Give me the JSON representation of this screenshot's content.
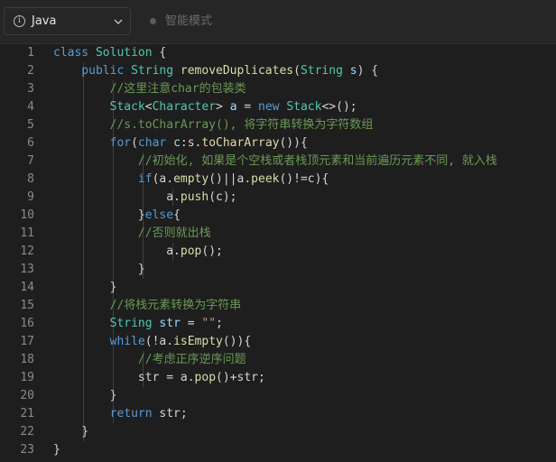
{
  "toolbar": {
    "language_label": "Java",
    "mode_label": "智能模式"
  },
  "editor": {
    "line_numbers": [
      "1",
      "2",
      "3",
      "4",
      "5",
      "6",
      "7",
      "8",
      "9",
      "10",
      "11",
      "12",
      "13",
      "14",
      "15",
      "16",
      "17",
      "18",
      "19",
      "20",
      "21",
      "22",
      "23"
    ],
    "lines": [
      [
        {
          "t": "class ",
          "c": "kw"
        },
        {
          "t": "Solution",
          "c": "ty"
        },
        {
          "t": " {",
          "c": "pl"
        }
      ],
      [
        {
          "t": "    public ",
          "c": "kw"
        },
        {
          "t": "String ",
          "c": "ty"
        },
        {
          "t": "removeDuplicates",
          "c": "fn"
        },
        {
          "t": "(",
          "c": "pl"
        },
        {
          "t": "String ",
          "c": "ty"
        },
        {
          "t": "s",
          "c": "vr"
        },
        {
          "t": ") {",
          "c": "pl"
        }
      ],
      [
        {
          "t": "        //这里注意char的包装类",
          "c": "cm"
        }
      ],
      [
        {
          "t": "        ",
          "c": "pl"
        },
        {
          "t": "Stack",
          "c": "ty"
        },
        {
          "t": "<",
          "c": "pl"
        },
        {
          "t": "Character",
          "c": "ty"
        },
        {
          "t": "> ",
          "c": "pl"
        },
        {
          "t": "a",
          "c": "vr"
        },
        {
          "t": " = ",
          "c": "pl"
        },
        {
          "t": "new ",
          "c": "kw"
        },
        {
          "t": "Stack",
          "c": "ty"
        },
        {
          "t": "<>();",
          "c": "pl"
        }
      ],
      [
        {
          "t": "        //s.toCharArray(), 将字符串转换为字符数组",
          "c": "cm"
        }
      ],
      [
        {
          "t": "        for",
          "c": "kw"
        },
        {
          "t": "(",
          "c": "pl"
        },
        {
          "t": "char ",
          "c": "kw"
        },
        {
          "t": "c",
          "c": "vr"
        },
        {
          "t": ":s.",
          "c": "pl"
        },
        {
          "t": "toCharArray",
          "c": "fn"
        },
        {
          "t": "()){",
          "c": "pl"
        }
      ],
      [
        {
          "t": "            //初始化, 如果是个空栈或者栈顶元素和当前遍历元素不同, 就入栈",
          "c": "cm"
        }
      ],
      [
        {
          "t": "            if",
          "c": "kw"
        },
        {
          "t": "(a.",
          "c": "pl"
        },
        {
          "t": "empty",
          "c": "fn"
        },
        {
          "t": "()||a.",
          "c": "pl"
        },
        {
          "t": "peek",
          "c": "fn"
        },
        {
          "t": "()!=c){",
          "c": "pl"
        }
      ],
      [
        {
          "t": "                a.",
          "c": "pl"
        },
        {
          "t": "push",
          "c": "fn"
        },
        {
          "t": "(c);",
          "c": "pl"
        }
      ],
      [
        {
          "t": "            }",
          "c": "pl"
        },
        {
          "t": "else",
          "c": "kw"
        },
        {
          "t": "{",
          "c": "pl"
        }
      ],
      [
        {
          "t": "            //否则就出栈",
          "c": "cm"
        }
      ],
      [
        {
          "t": "                a.",
          "c": "pl"
        },
        {
          "t": "pop",
          "c": "fn"
        },
        {
          "t": "();",
          "c": "pl"
        }
      ],
      [
        {
          "t": "            }",
          "c": "pl"
        }
      ],
      [
        {
          "t": "        }",
          "c": "pl"
        }
      ],
      [
        {
          "t": "        //将栈元素转换为字符串",
          "c": "cm"
        }
      ],
      [
        {
          "t": "        ",
          "c": "pl"
        },
        {
          "t": "String ",
          "c": "ty"
        },
        {
          "t": "str",
          "c": "vr"
        },
        {
          "t": " = ",
          "c": "pl"
        },
        {
          "t": "\"\"",
          "c": "st"
        },
        {
          "t": ";",
          "c": "pl"
        }
      ],
      [
        {
          "t": "        while",
          "c": "kw"
        },
        {
          "t": "(!a.",
          "c": "pl"
        },
        {
          "t": "isEmpty",
          "c": "fn"
        },
        {
          "t": "()){",
          "c": "pl"
        }
      ],
      [
        {
          "t": "            //考虑正序逆序问题",
          "c": "cm"
        }
      ],
      [
        {
          "t": "            str = a.",
          "c": "pl"
        },
        {
          "t": "pop",
          "c": "fn"
        },
        {
          "t": "()+str;",
          "c": "pl"
        }
      ],
      [
        {
          "t": "        }",
          "c": "pl"
        }
      ],
      [
        {
          "t": "        return ",
          "c": "kw"
        },
        {
          "t": "str;",
          "c": "pl"
        }
      ],
      [
        {
          "t": "    }",
          "c": "pl"
        }
      ],
      [
        {
          "t": "}",
          "c": "pl"
        }
      ]
    ]
  },
  "colors": {
    "keyword": "#569cd6",
    "type": "#4ec9b0",
    "function": "#dcdcaa",
    "comment": "#6a9955",
    "string": "#ce9178",
    "plain": "#d4d4d4"
  }
}
